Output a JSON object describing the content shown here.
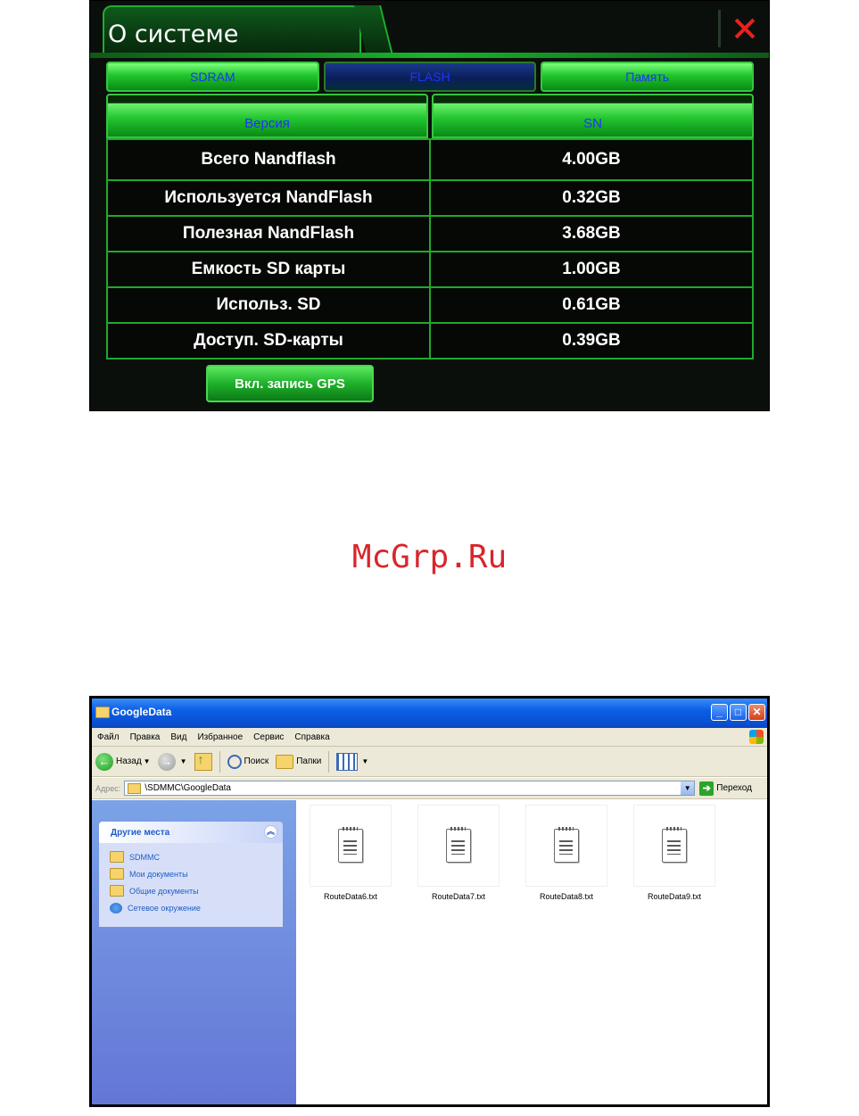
{
  "system": {
    "title": "О системе",
    "tabs": [
      "SDRAM",
      "FLASH",
      "Память"
    ],
    "active_tab": "FLASH",
    "headers": [
      "Версия",
      "SN"
    ],
    "rows": [
      {
        "label": "Всего Nandflash",
        "value": "4.00GB"
      },
      {
        "label": "Используется NandFlash",
        "value": "0.32GB"
      },
      {
        "label": "Полезная NandFlash",
        "value": "3.68GB"
      },
      {
        "label": "Емкость SD карты",
        "value": "1.00GB"
      },
      {
        "label": "Использ. SD",
        "value": "0.61GB"
      },
      {
        "label": "Доступ. SD-карты",
        "value": "0.39GB"
      }
    ],
    "gps_button": "Вкл. запись GPS",
    "colors": {
      "accent": "#1fae2e",
      "close": "#e5231e",
      "tab_text": "#1f33ff"
    }
  },
  "watermark": "McGrp.Ru",
  "explorer": {
    "title": "GoogleData",
    "menu": [
      "Файл",
      "Правка",
      "Вид",
      "Избранное",
      "Сервис",
      "Справка"
    ],
    "toolbar": {
      "back": "Назад",
      "search": "Поиск",
      "folders": "Папки"
    },
    "address_label": "Адрес:",
    "address": "\\SDMMC\\GoogleData",
    "go": "Переход",
    "panel": {
      "title": "Другие места",
      "links": [
        "SDMMC",
        "Мои документы",
        "Общие документы",
        "Сетевое окружение"
      ]
    },
    "files": [
      "RouteData6.txt",
      "RouteData7.txt",
      "RouteData8.txt",
      "RouteData9.txt"
    ]
  }
}
